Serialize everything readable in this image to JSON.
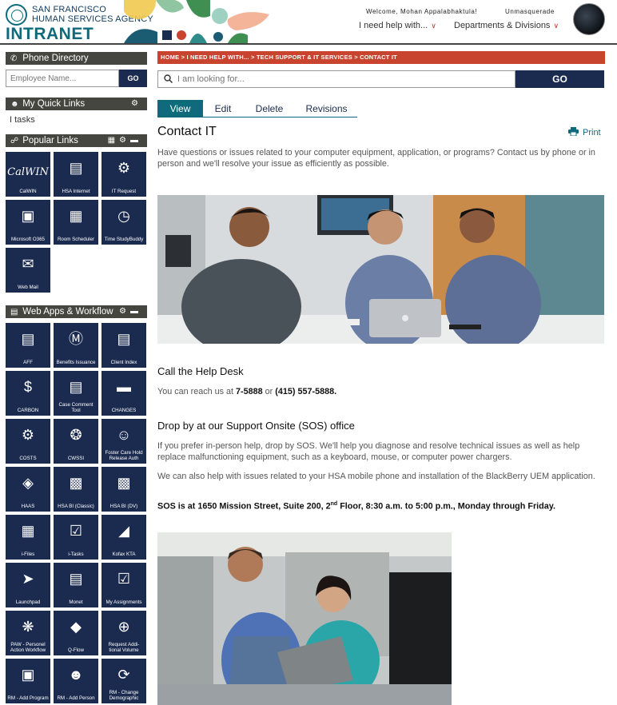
{
  "header": {
    "logo_line1": "SAN FRANCISCO",
    "logo_line2": "HUMAN SERVICES AGENCY",
    "logo_main": "INTRANET",
    "welcome": "Welcome, Mohan Appalabhaktula!",
    "unmasquerade": "Unmasquerade",
    "nav_help": "I need help with...",
    "nav_departments": "Departments & Divisions"
  },
  "sidebar": {
    "phone_directory": {
      "title": "Phone Directory",
      "placeholder": "Employee Name...",
      "go": "GO"
    },
    "quick_links": {
      "title": "My Quick Links",
      "items": [
        "I tasks"
      ]
    },
    "popular_links": {
      "title": "Popular Links",
      "tiles": [
        {
          "label": "CalWIN",
          "icon": "calwin-logo"
        },
        {
          "label": "HSA Internet",
          "icon": "browser-icon"
        },
        {
          "label": "IT Request",
          "icon": "hand-gear-icon"
        },
        {
          "label": "Microsoft O365",
          "icon": "office-icon"
        },
        {
          "label": "Room Scheduler",
          "icon": "calendar-clock-icon"
        },
        {
          "label": "Time StudyBuddy",
          "icon": "book-clock-icon"
        },
        {
          "label": "Web Mail",
          "icon": "outlook-icon"
        }
      ]
    },
    "web_apps": {
      "title": "Web Apps & Workflow",
      "tiles": [
        {
          "label": "AFF",
          "icon": "document-icon"
        },
        {
          "label": "Benefits Issuance",
          "icon": "coin-icon"
        },
        {
          "label": "Client Index",
          "icon": "index-card-icon"
        },
        {
          "label": "CARBON",
          "icon": "dollar-doc-icon"
        },
        {
          "label": "Case Comment Tool",
          "icon": "comment-doc-icon"
        },
        {
          "label": "CHANGES",
          "icon": "bed-icon"
        },
        {
          "label": "COSTS",
          "icon": "gear-dollar-icon"
        },
        {
          "label": "CWSSI",
          "icon": "network-icon"
        },
        {
          "label": "Foster Care Hold Release Auth",
          "icon": "people-icon"
        },
        {
          "label": "HAAS",
          "icon": "drop-icon"
        },
        {
          "label": "HSA BI (Classic)",
          "icon": "bar-chart-icon"
        },
        {
          "label": "HSA BI (DV)",
          "icon": "bar-chart-icon"
        },
        {
          "label": "i-Files",
          "icon": "folder-icon"
        },
        {
          "label": "i-Tasks",
          "icon": "clipboard-check-icon"
        },
        {
          "label": "Kofax KTA",
          "icon": "scanner-icon"
        },
        {
          "label": "Launchpad",
          "icon": "rocket-icon"
        },
        {
          "label": "Monet",
          "icon": "monitor-doc-icon"
        },
        {
          "label": "My Assignments",
          "icon": "clipboard-icon"
        },
        {
          "label": "PAW - Personel Action Workflow",
          "icon": "paw-icon"
        },
        {
          "label": "Q-Flow",
          "icon": "ticket-icon"
        },
        {
          "label": "Request Addi- tional Volume",
          "icon": "plus-circle-icon"
        },
        {
          "label": "RM - Add Program",
          "icon": "inbox-plus-icon"
        },
        {
          "label": "RM - Add Person",
          "icon": "person-plus-icon"
        },
        {
          "label": "RM - Change Demographic",
          "icon": "cycle-icon"
        }
      ]
    }
  },
  "main": {
    "breadcrumb": "HOME > I NEED HELP WITH... > TECH SUPPORT & IT SERVICES > CONTACT IT",
    "search_placeholder": "I am looking for...",
    "search_go": "GO",
    "tabs": [
      "View",
      "Edit",
      "Delete",
      "Revisions"
    ],
    "title": "Contact IT",
    "print": "Print",
    "intro": "Have questions or issues related to your computer equipment, application, or programs? Contact us by phone or in person and we'll resolve your issue as efficiently as possible.",
    "help_desk_heading": "Call the Help Desk",
    "help_desk_text_pre": "You can reach us at ",
    "help_desk_ext": "7-5888",
    "help_desk_or": " or ",
    "help_desk_phone": "(415) 557-5888.",
    "sos_heading": "Drop by at our Support Onsite (SOS) office",
    "sos_p1": "If you prefer in-person help, drop by SOS. We'll help you diagnose and resolve technical issues as well as help replace malfunctioning equipment, such as a keyboard, mouse, or computer power chargers.",
    "sos_p2": "We can also help with issues related to your HSA mobile phone and installation of the BlackBerry UEM application.",
    "sos_address_pre": "SOS is at 1650 Mission Street, Suite 200, 2",
    "sos_address_sup": "nd",
    "sos_address_post": " Floor, 8:30 a.m. to 5:00 p.m., Monday through Friday."
  },
  "colors": {
    "navy": "#1b2a4f",
    "teal": "#0f6b7b",
    "breadcrumb_red": "#c9442f",
    "sidebar_header": "#45463f"
  }
}
